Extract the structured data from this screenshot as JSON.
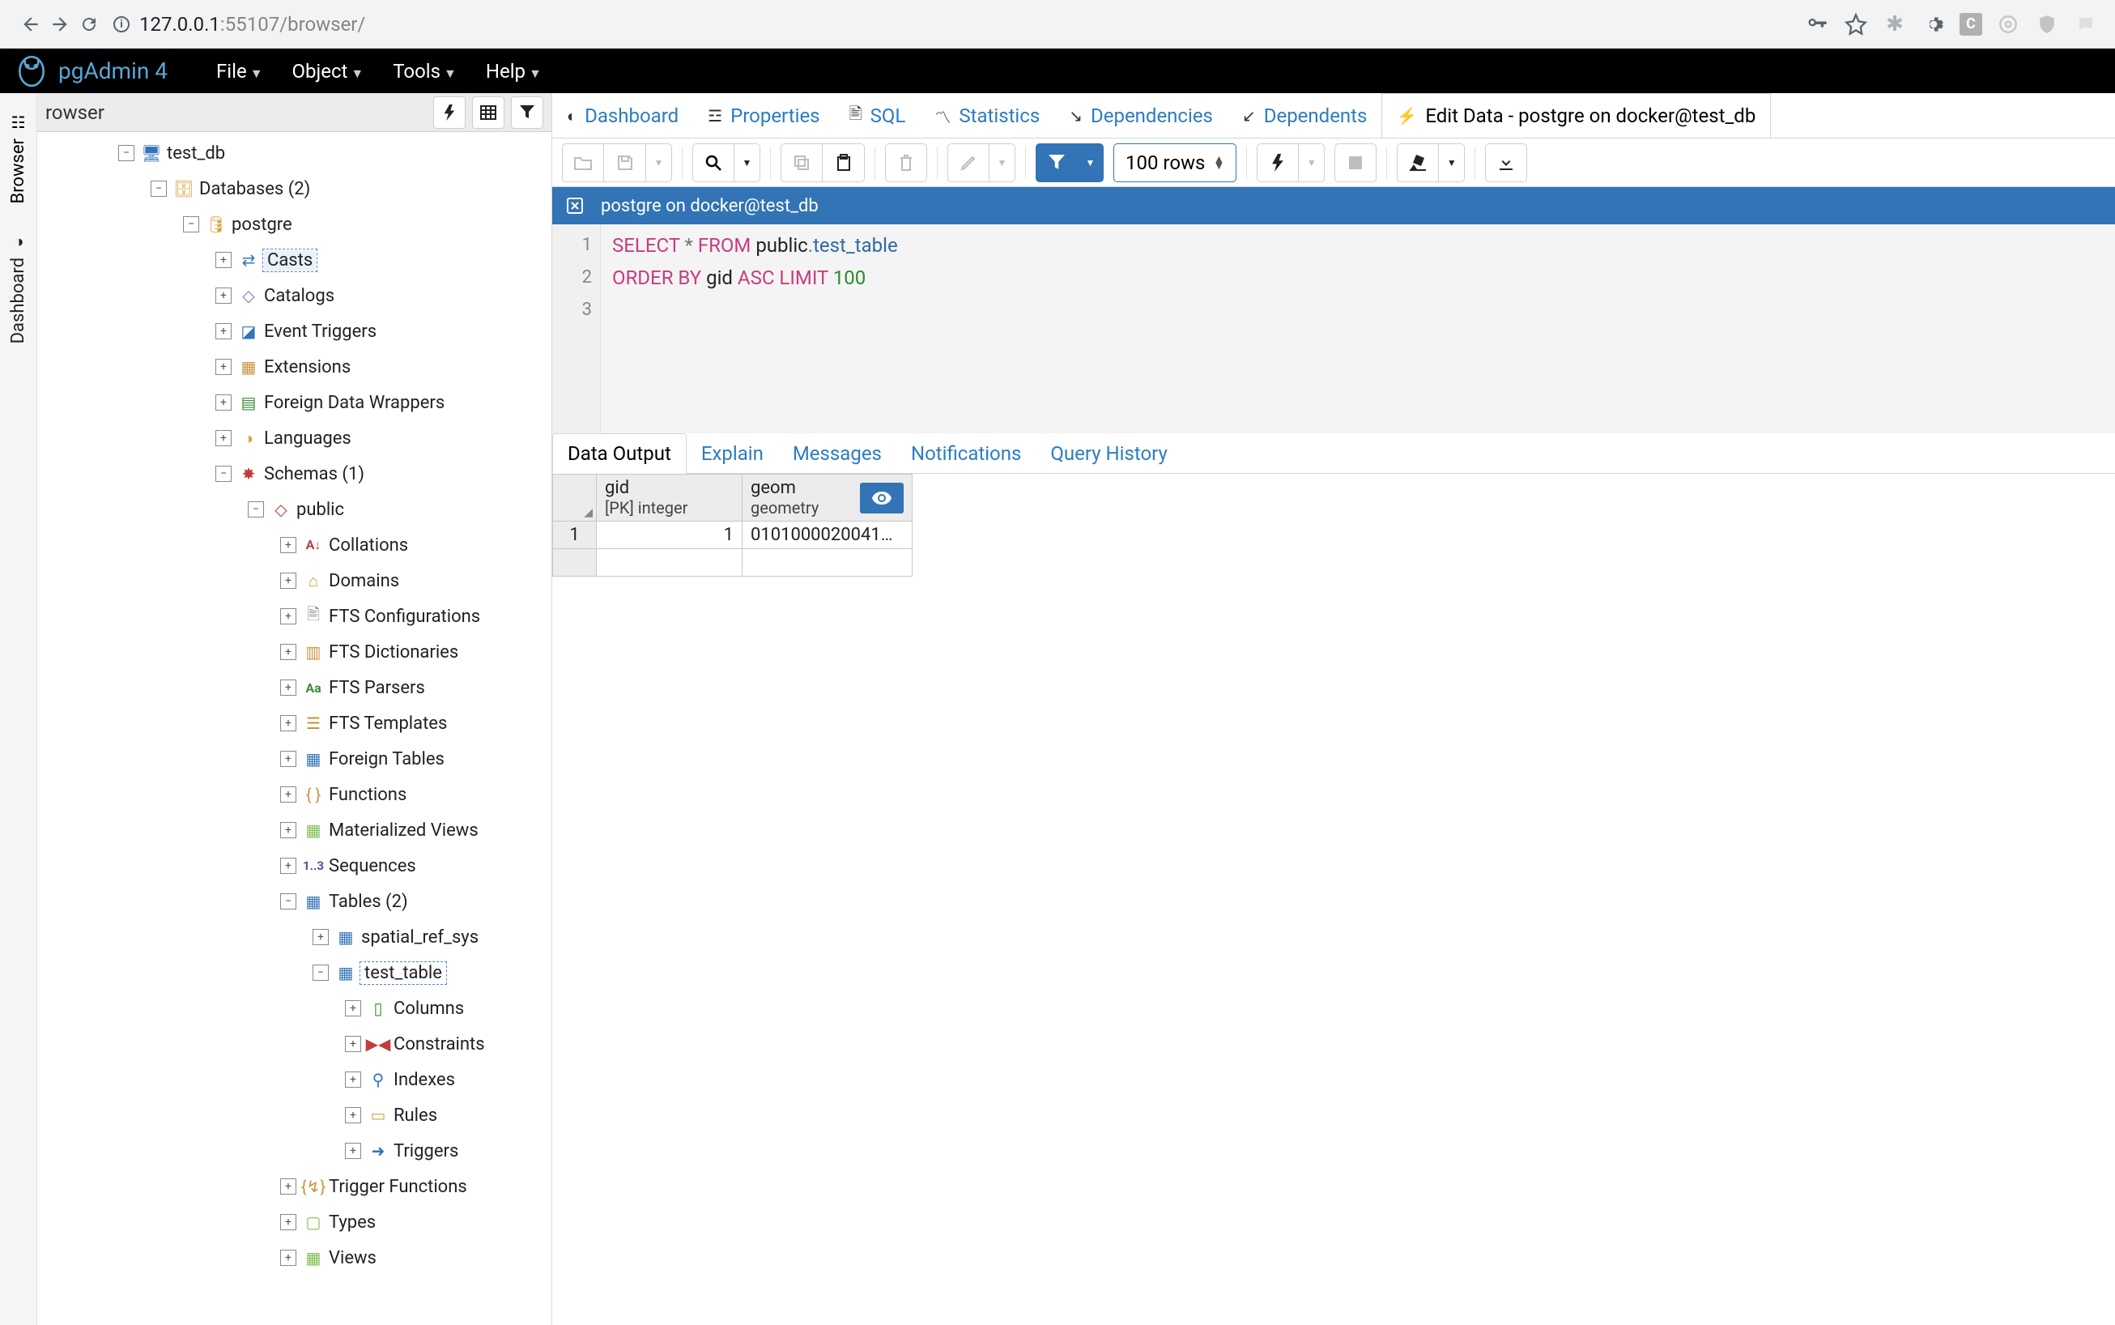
{
  "browser": {
    "url_host": "127.0.0.1",
    "url_port": ":55107",
    "url_path": "/browser/"
  },
  "brand": "pgAdmin 4",
  "menubar": [
    "File",
    "Object",
    "Tools",
    "Help"
  ],
  "vtabs": {
    "browser": "Browser",
    "dashboard": "Dashboard"
  },
  "side": {
    "title": "rowser"
  },
  "tree": {
    "test_db": "test_db",
    "databases": "Databases (2)",
    "postgre": "postgre",
    "casts": "Casts",
    "catalogs": "Catalogs",
    "event_triggers": "Event Triggers",
    "extensions": "Extensions",
    "fdw": "Foreign Data Wrappers",
    "languages": "Languages",
    "schemas": "Schemas (1)",
    "public": "public",
    "collations": "Collations",
    "domains": "Domains",
    "fts_conf": "FTS Configurations",
    "fts_dict": "FTS Dictionaries",
    "fts_pars": "FTS Parsers",
    "fts_tmpl": "FTS Templates",
    "foreign_tables": "Foreign Tables",
    "functions": "Functions",
    "mviews": "Materialized Views",
    "sequences": "Sequences",
    "tables": "Tables (2)",
    "spatial_ref_sys": "spatial_ref_sys",
    "test_table": "test_table",
    "columns": "Columns",
    "constraints": "Constraints",
    "indexes": "Indexes",
    "rules": "Rules",
    "triggers": "Triggers",
    "trigger_functions": "Trigger Functions",
    "types": "Types",
    "views": "Views"
  },
  "ptabs": {
    "dashboard": "Dashboard",
    "properties": "Properties",
    "sql": "SQL",
    "statistics": "Statistics",
    "dependencies": "Dependencies",
    "dependents": "Dependents",
    "edit": "Edit Data - postgre on docker@test_db"
  },
  "rowlimit": "100 rows",
  "conn": "postgre on docker@test_db",
  "sql": {
    "l1": {
      "a": "SELECT",
      "b": " * ",
      "c": "FROM",
      "d": " public",
      "e": ".",
      "f": "test_table"
    },
    "l2": {
      "a": "ORDER BY",
      "b": " gid ",
      "c": "ASC",
      "d": " LIMIT ",
      "e": "100"
    }
  },
  "rtabs": {
    "data_output": "Data Output",
    "explain": "Explain",
    "messages": "Messages",
    "notifications": "Notifications",
    "query_history": "Query History"
  },
  "grid": {
    "h1a": "gid",
    "h1b": "[PK] integer",
    "h2a": "geom",
    "h2b": "geometry",
    "r1_num": "1",
    "r1_gid": "1",
    "r1_geom": "0101000020041…"
  }
}
